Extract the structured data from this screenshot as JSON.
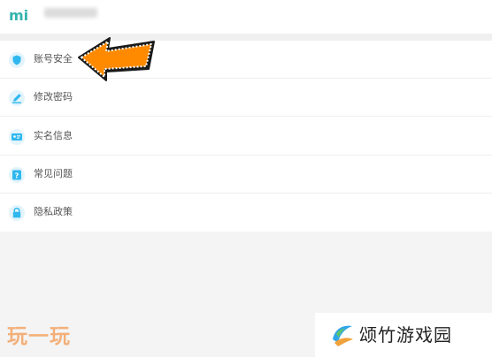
{
  "header": {
    "logo_text": "mi",
    "username": "",
    "accent_color": "#36b3ad"
  },
  "menu": {
    "icon_color": "#2fb8ef",
    "items": [
      {
        "label": "账号安全",
        "icon": "shield-icon"
      },
      {
        "label": "修改密码",
        "icon": "pencil-icon"
      },
      {
        "label": "实名信息",
        "icon": "id-card-icon"
      },
      {
        "label": "常见问题",
        "icon": "question-icon"
      },
      {
        "label": "隐私政策",
        "icon": "lock-icon"
      }
    ]
  },
  "annotation": {
    "arrow_color": "#ff8a00",
    "points_to": "账号安全"
  },
  "watermarks": {
    "left_text": "玩一玩",
    "right_text": "颂竹游戏园"
  }
}
